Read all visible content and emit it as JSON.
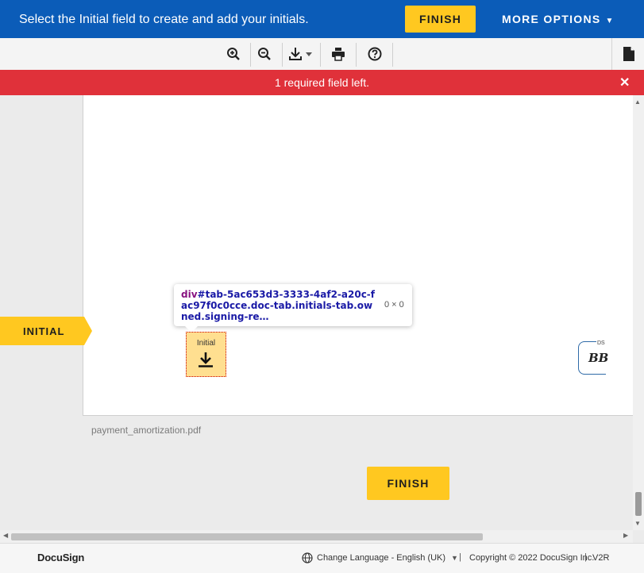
{
  "header": {
    "message": "Select the Initial field to create and add your initials.",
    "finish_label": "FINISH",
    "more_options_label": "MORE OPTIONS",
    "accent_color": "#0b5cb8",
    "button_color": "#ffc820"
  },
  "toolbar": {
    "icons": [
      "zoom-in-icon",
      "zoom-out-icon",
      "download-icon",
      "print-icon",
      "help-icon",
      "document-icon"
    ]
  },
  "alert": {
    "text": "1 required field left.",
    "close_glyph": "✕",
    "color": "#e0313a"
  },
  "document": {
    "initial_flag_label": "INITIAL",
    "initial_tab_label": "Initial",
    "filename": "payment_amortization.pdf",
    "ds_label": "DS",
    "ds_initials": "BB"
  },
  "inspector_tooltip": {
    "tag": "div",
    "selector": "#tab-5ac653d3-3333-4af2-a20c-fac97f0c0cce.doc-tab.initials-tab.owned.signing-re…",
    "dimensions": "0 × 0"
  },
  "bottom": {
    "finish_label": "FINISH"
  },
  "footer": {
    "logo": "DocuSign",
    "language": "Change Language - English (UK)",
    "copyright": "Copyright © 2022 DocuSign Inc.",
    "version": "V2R"
  }
}
